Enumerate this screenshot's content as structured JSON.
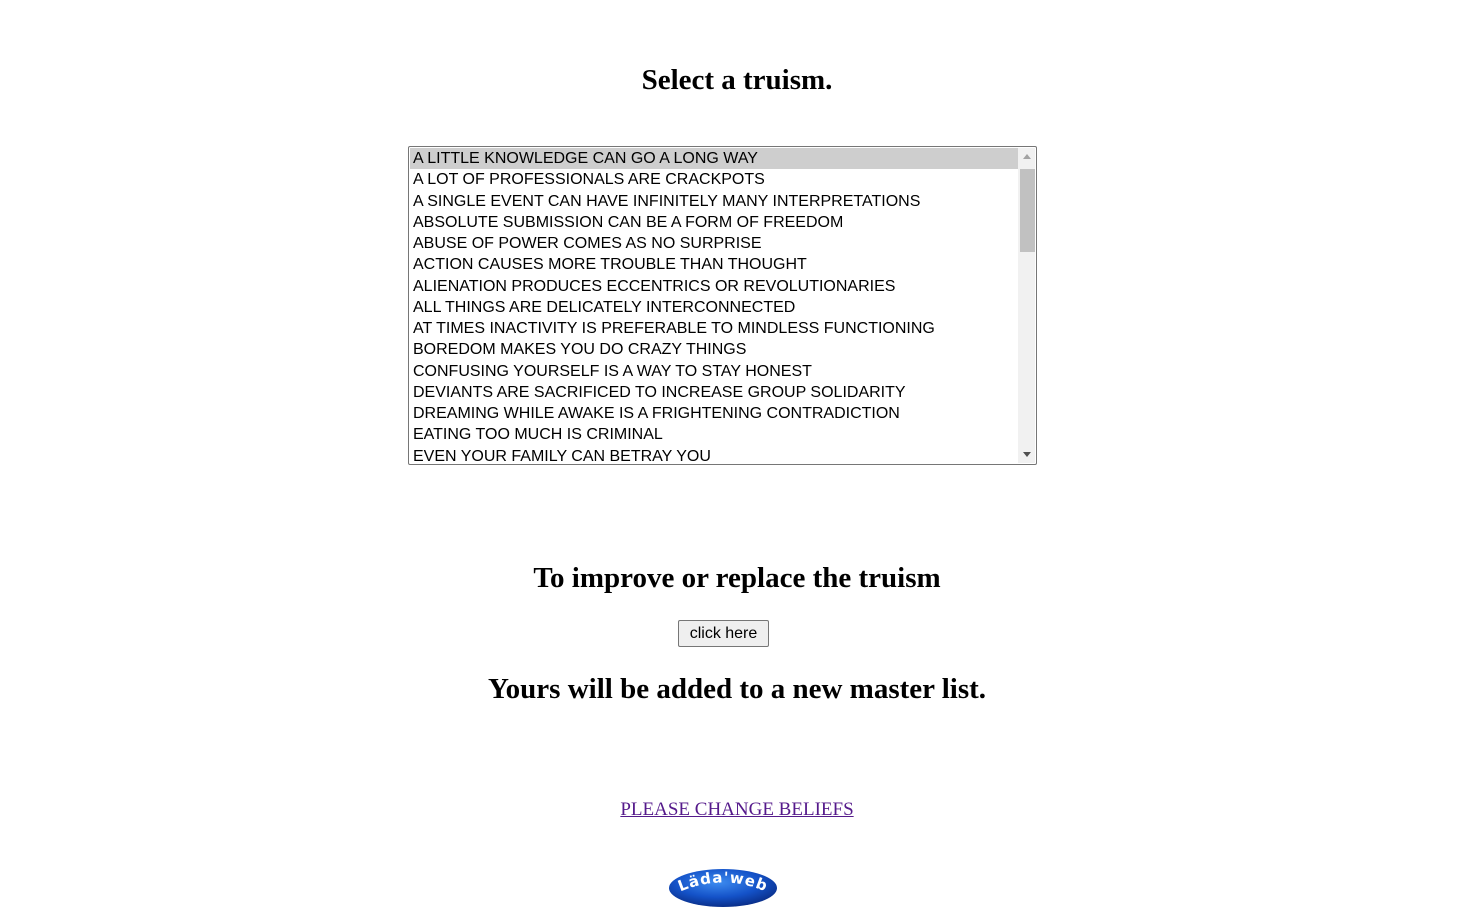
{
  "title": "Select a truism.",
  "truisms": {
    "options": [
      "A LITTLE KNOWLEDGE CAN GO A LONG WAY",
      "A LOT OF PROFESSIONALS ARE CRACKPOTS",
      "A SINGLE EVENT CAN HAVE INFINITELY MANY INTERPRETATIONS",
      "ABSOLUTE SUBMISSION CAN BE A FORM OF FREEDOM",
      "ABUSE OF POWER COMES AS NO SURPRISE",
      "ACTION CAUSES MORE TROUBLE THAN THOUGHT",
      "ALIENATION PRODUCES ECCENTRICS OR REVOLUTIONARIES",
      "ALL THINGS ARE DELICATELY INTERCONNECTED",
      "AT TIMES INACTIVITY IS PREFERABLE TO MINDLESS FUNCTIONING",
      "BOREDOM MAKES YOU DO CRAZY THINGS",
      "CONFUSING YOURSELF IS A WAY TO STAY HONEST",
      "DEVIANTS ARE SACRIFICED TO INCREASE GROUP SOLIDARITY",
      "DREAMING WHILE AWAKE IS A FRIGHTENING CONTRADICTION",
      "EATING TOO MUCH IS CRIMINAL",
      "EVEN YOUR FAMILY CAN BETRAY YOU"
    ],
    "selected": "A LITTLE KNOWLEDGE CAN GO A LONG WAY",
    "scroll_position": 0
  },
  "improve_heading": "To improve or replace the truism",
  "click_button_label": "click here",
  "added_heading": "Yours will be added to a new master list.",
  "change_link_text": "PLEASE CHANGE BELIEFS",
  "logo": {
    "text": "Läda'web",
    "icon": "adaweb-logo",
    "color": "#1452c8"
  },
  "colors": {
    "link_visited": "#551a8b",
    "selected_option_bg": "#cecece"
  }
}
